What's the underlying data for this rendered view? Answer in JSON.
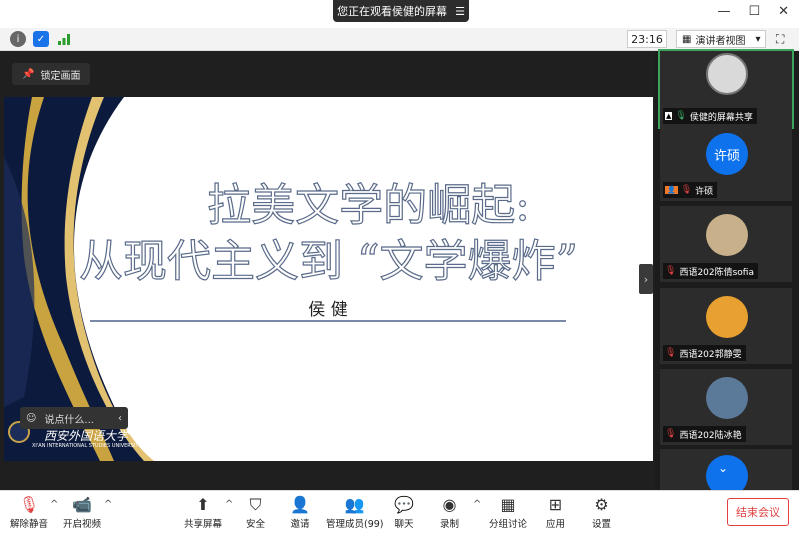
{
  "banner": {
    "text": "您正在观看侯健的屏幕",
    "menu_icon": "menu-icon"
  },
  "window": {
    "minimize": "—",
    "maximize": "☐",
    "close": "✕"
  },
  "infobar": {
    "timer": "23:16",
    "view_label": "演讲者视图",
    "view_caret": "▾"
  },
  "main": {
    "lock_label": "锁定画面",
    "chat_placeholder": "说点什么...",
    "slide": {
      "title_line1": "拉美文学的崛起:",
      "title_line2": "从现代主义到 “文学爆炸”",
      "presenter": "侯 健",
      "university_cn": "西安外国语大学",
      "university_en": "XI'AN INTERNATIONAL STUDIES UNIVERSITY"
    }
  },
  "participants": [
    {
      "name": "侯健的屏幕共享",
      "active": true,
      "avatar_color": "#d9d9d9"
    },
    {
      "name": "许硕",
      "avatar_text": "许硕",
      "avatar_color": "#0e72ed"
    },
    {
      "name": "西语202陈倩sofia",
      "avatar_color": "#c7b08a"
    },
    {
      "name": "西语202郭静雯",
      "avatar_color": "#e8a030"
    },
    {
      "name": "西语202陆冰艳",
      "avatar_color": "#5b7a9a"
    }
  ],
  "toolbar": {
    "unmute": "解除静音",
    "start_video": "开启视频",
    "share_screen": "共享屏幕",
    "security": "安全",
    "invite": "邀请",
    "manage": "管理成员(99)",
    "chat": "聊天",
    "record": "录制",
    "breakout": "分组讨论",
    "apps": "应用",
    "settings": "设置",
    "end_meeting": "结束会议"
  },
  "colors": {
    "accent_blue": "#0e72ed",
    "end_red": "#e04040",
    "active_green": "#3ba55d"
  }
}
